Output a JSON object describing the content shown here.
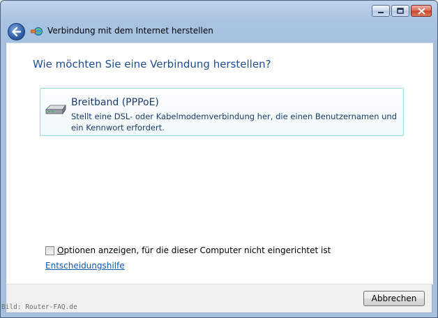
{
  "window": {
    "title": "Verbindung mit dem Internet herstellen",
    "colors": {
      "frame": "#a6c0e0",
      "heading": "#1e4e9a",
      "link": "#0a58b8",
      "option_border": "#9ad6ec"
    }
  },
  "main": {
    "heading": "Wie möchten Sie eine Verbindung herstellen?",
    "option": {
      "icon": "broadband-modem-icon",
      "title": "Breitband (PPPoE)",
      "description": "Stellt eine DSL- oder Kabelmodemverbindung her, die einen Benutzernamen und ein Kennwort erfordert."
    },
    "checkbox": {
      "underlined": "O",
      "label": "ptionen anzeigen, für die dieser Computer nicht eingerichtet ist",
      "checked": false
    },
    "help_link": "Entscheidungshilfe"
  },
  "footer": {
    "watermark": "Bild: Router-FAQ.de",
    "cancel_label": "Abbrechen"
  }
}
